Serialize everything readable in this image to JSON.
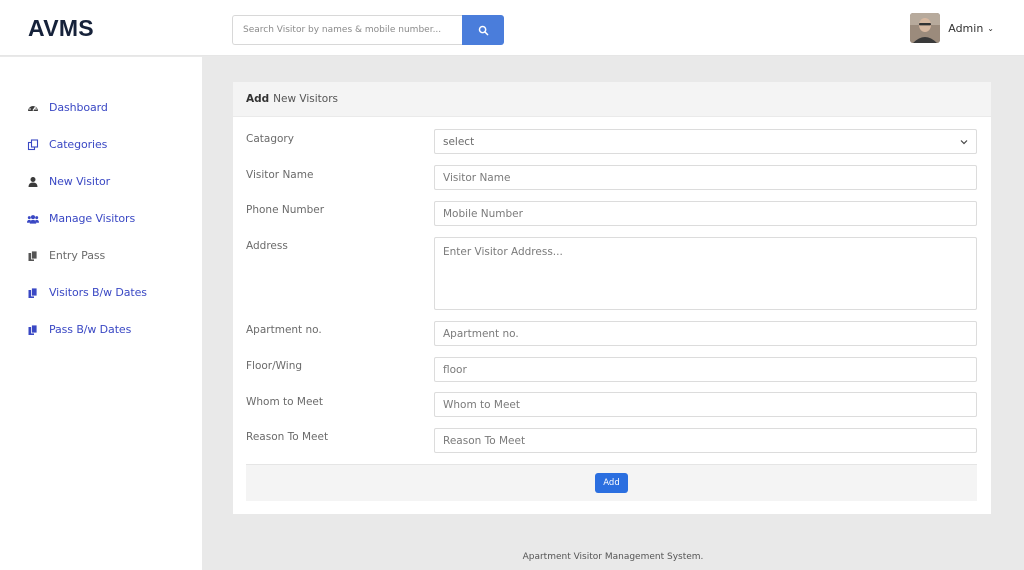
{
  "brand": {
    "title": "AVMS"
  },
  "search": {
    "placeholder": "Search Visitor by names & mobile number..."
  },
  "user": {
    "name": "Admin",
    "caret": "⌄"
  },
  "colors": {
    "accent": "#4a7ddb",
    "nav_link": "#3a48c4",
    "add_button": "#2b6fe0"
  },
  "sidebar": {
    "items": [
      {
        "label": "Dashboard",
        "icon": "dashboard-icon"
      },
      {
        "label": "Categories",
        "icon": "copy-icon"
      },
      {
        "label": "New Visitor",
        "icon": "user-icon"
      },
      {
        "label": "Manage Visitors",
        "icon": "users-icon"
      },
      {
        "label": "Entry Pass",
        "icon": "files-icon"
      },
      {
        "label": "Visitors B/w Dates",
        "icon": "files-icon"
      },
      {
        "label": "Pass B/w Dates",
        "icon": "files-icon"
      }
    ]
  },
  "panel": {
    "title_bold": "Add",
    "title_rest": "New Visitors"
  },
  "form": {
    "category": {
      "label": "Catagory",
      "value": "select"
    },
    "visitor_name": {
      "label": "Visitor Name",
      "placeholder": "Visitor Name"
    },
    "phone": {
      "label": "Phone Number",
      "placeholder": "Mobile Number"
    },
    "address": {
      "label": "Address",
      "placeholder": "Enter Visitor Address..."
    },
    "apartment": {
      "label": "Apartment no.",
      "placeholder": "Apartment no."
    },
    "floor": {
      "label": "Floor/Wing",
      "placeholder": "floor"
    },
    "whom": {
      "label": "Whom to Meet",
      "placeholder": "Whom to Meet"
    },
    "reason": {
      "label": "Reason To Meet",
      "placeholder": "Reason To Meet"
    },
    "submit_label": "Add"
  },
  "footer": {
    "text": "Apartment Visitor Management System."
  }
}
